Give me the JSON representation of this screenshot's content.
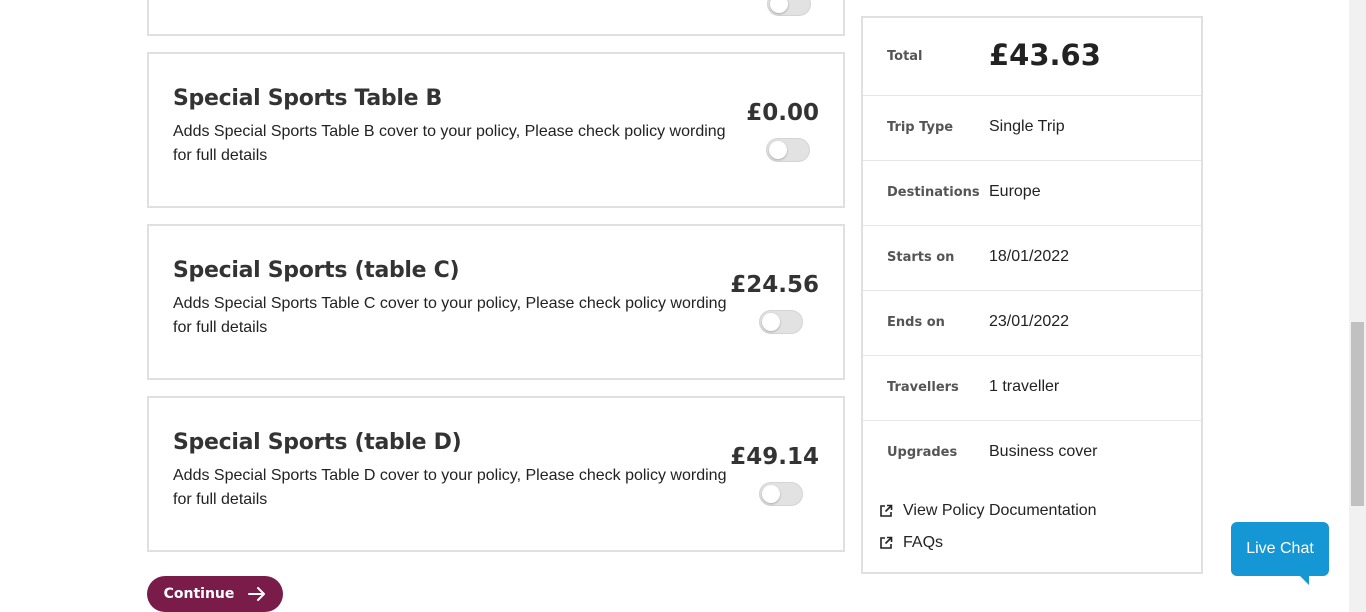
{
  "addons": [
    {
      "title": "Special Sports Table B",
      "description": "Adds Special Sports Table B cover to your policy, Please check policy wording for full details",
      "price": "£0.00",
      "enabled": false
    },
    {
      "title": "Special Sports (table C)",
      "description": "Adds Special Sports Table C cover to your policy, Please check policy wording for full details",
      "price": "£24.56",
      "enabled": false
    },
    {
      "title": "Special Sports (table D)",
      "description": "Adds Special Sports Table D cover to your policy, Please check policy wording for full details",
      "price": "£49.14",
      "enabled": false
    }
  ],
  "continue_label": "Continue",
  "summary": {
    "total_label": "Total",
    "total_value": "£43.63",
    "rows": [
      {
        "label": "Trip Type",
        "value": "Single Trip"
      },
      {
        "label": "Destinations",
        "value": "Europe"
      },
      {
        "label": "Starts on",
        "value": "18/01/2022"
      },
      {
        "label": "Ends on",
        "value": "23/01/2022"
      },
      {
        "label": "Travellers",
        "value": "1 traveller"
      },
      {
        "label": "Upgrades",
        "value": "Business cover"
      }
    ],
    "links": [
      "View Policy Documentation",
      "FAQs"
    ]
  },
  "live_chat_label": "Live Chat",
  "colors": {
    "primary_button": "#7a1c4a",
    "live_chat": "#1596d5"
  }
}
